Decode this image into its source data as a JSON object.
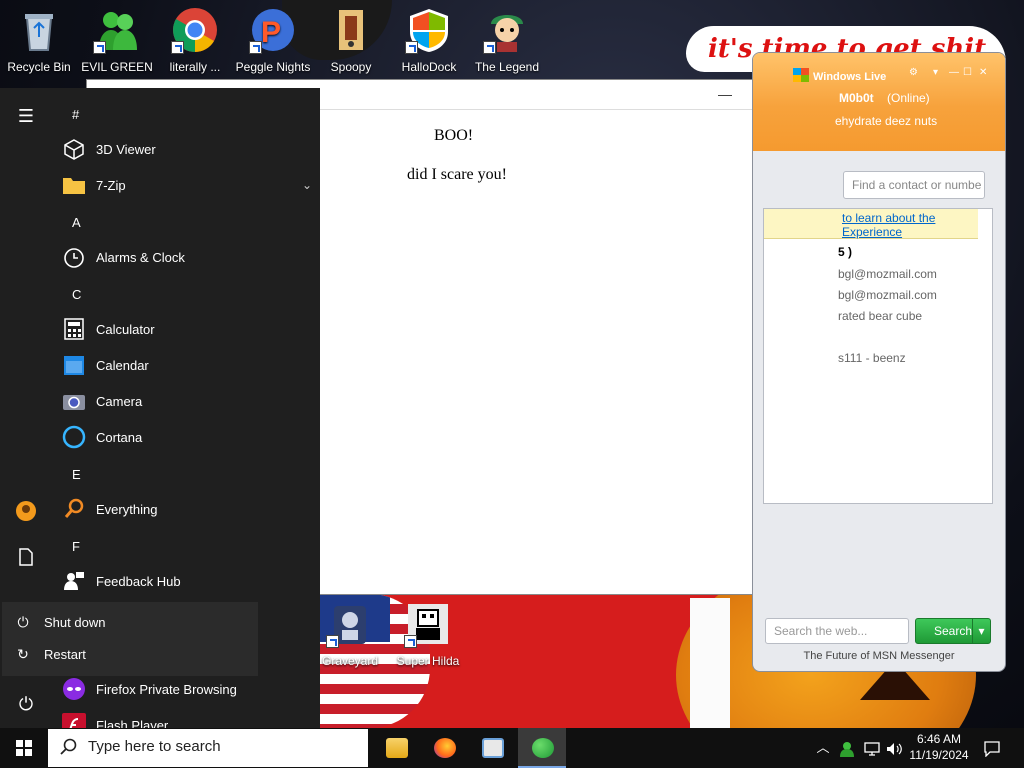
{
  "wallpaper": {
    "banner_text": "it's time to get shit"
  },
  "desktop_icons": [
    {
      "label": "Recycle Bin"
    },
    {
      "label": "EVIL GREEN MEN CO"
    },
    {
      "label": "literally ..."
    },
    {
      "label": "Peggle Nights Del..."
    },
    {
      "label": "Spoopy"
    },
    {
      "label": "HalloDock"
    },
    {
      "label": "The Legend of Til..."
    },
    {
      "label": "Graveyard Party Scre..."
    },
    {
      "label": "Super Hilda"
    }
  ],
  "web_window": {
    "minimize": "—",
    "maximize": "☐",
    "close": "✕",
    "heading": "BOO!",
    "body": "did I scare you!"
  },
  "msn": {
    "brand": "Windows Live",
    "user": "M0b0t",
    "status": "(Online)",
    "personal_message": "ehydrate deez nuts",
    "find_placeholder": "Find a contact or numbe",
    "banner_line1": "to learn about the",
    "banner_line2": "Experience",
    "group_header": "5 )",
    "contacts": [
      "bgl@mozmail.com",
      "bgl@mozmail.com",
      "rated bear cube",
      "s111 - beenz"
    ],
    "search_placeholder": "Search the web...",
    "search_button": "Search",
    "footer": "The Future of MSN Messenger"
  },
  "start_menu": {
    "sections": [
      {
        "letter": "#",
        "apps": [
          {
            "name": "3D Viewer",
            "icon": "cube-icon"
          },
          {
            "name": "7-Zip",
            "icon": "folder-icon",
            "expandable": true
          }
        ]
      },
      {
        "letter": "A",
        "apps": [
          {
            "name": "Alarms & Clock",
            "icon": "clock-icon"
          }
        ]
      },
      {
        "letter": "C",
        "apps": [
          {
            "name": "Calculator",
            "icon": "calculator-icon"
          },
          {
            "name": "Calendar",
            "icon": "calendar-icon"
          },
          {
            "name": "Camera",
            "icon": "camera-icon"
          },
          {
            "name": "Cortana",
            "icon": "cortana-icon"
          }
        ]
      },
      {
        "letter": "E",
        "apps": [
          {
            "name": "Everything",
            "icon": "search-icon"
          }
        ]
      },
      {
        "letter": "F",
        "apps": [
          {
            "name": "Feedback Hub",
            "icon": "feedback-icon"
          },
          {
            "name": "Firefox Private Browsing",
            "icon": "mask-icon"
          },
          {
            "name": "Flash Player",
            "icon": "flash-icon"
          }
        ]
      }
    ],
    "power_menu": {
      "shutdown": "Shut down",
      "restart": "Restart"
    }
  },
  "taskbar": {
    "search_placeholder": "Type here to search",
    "time": "6:46 AM",
    "date": "11/19/2024"
  }
}
